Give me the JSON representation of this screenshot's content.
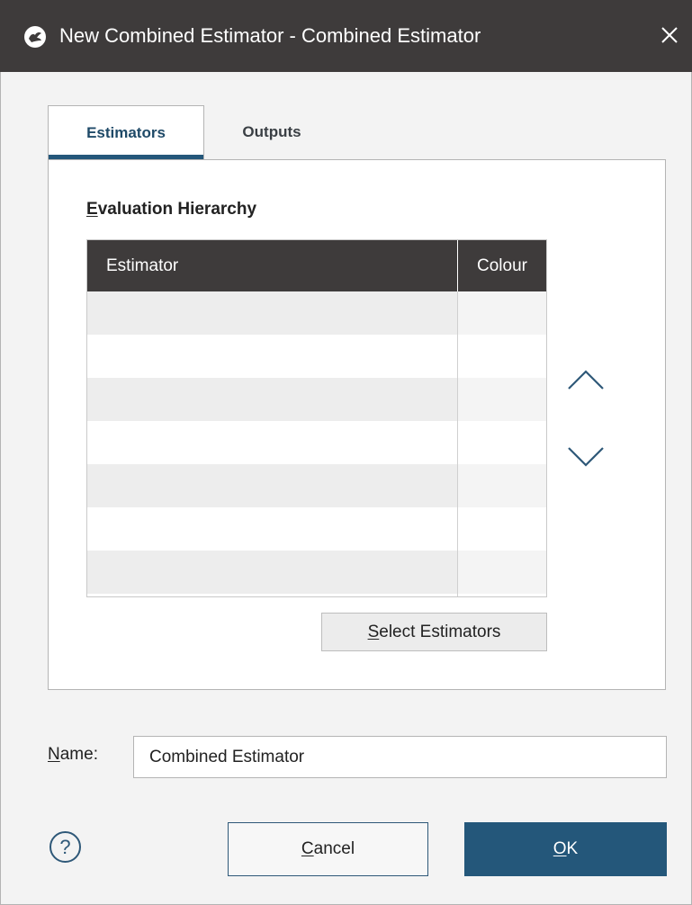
{
  "window": {
    "title": "New Combined Estimator - Combined Estimator",
    "app_icon": "leapfrog-logo-icon",
    "close_icon": "close-icon"
  },
  "tabs": [
    {
      "label": "Estimators",
      "selected": true
    },
    {
      "label": "Outputs",
      "selected": false
    }
  ],
  "evaluation_hierarchy": {
    "label_mnemonic": "E",
    "label_rest": "valuation Hierarchy",
    "columns": [
      "Estimator",
      "Colour"
    ],
    "rows": [
      {
        "estimator": "",
        "colour": ""
      },
      {
        "estimator": "",
        "colour": ""
      },
      {
        "estimator": "",
        "colour": ""
      },
      {
        "estimator": "",
        "colour": ""
      },
      {
        "estimator": "",
        "colour": ""
      },
      {
        "estimator": "",
        "colour": ""
      },
      {
        "estimator": "",
        "colour": ""
      }
    ],
    "move_up_icon": "chevron-up-icon",
    "move_down_icon": "chevron-down-icon"
  },
  "select_estimators": {
    "mnemonic": "S",
    "rest": "elect Estimators"
  },
  "name_field": {
    "label_mnemonic": "N",
    "label_rest": "ame:",
    "value": "Combined Estimator"
  },
  "footer": {
    "help_icon": "help-icon",
    "help_glyph": "?",
    "cancel_mnemonic": "C",
    "cancel_rest": "ancel",
    "ok_mnemonic": "O",
    "ok_rest": "K"
  },
  "colors": {
    "titlebar": "#3e3b3b",
    "accent": "#24577a",
    "table_header": "#3e3b3b",
    "row_alt": "#ededed"
  }
}
